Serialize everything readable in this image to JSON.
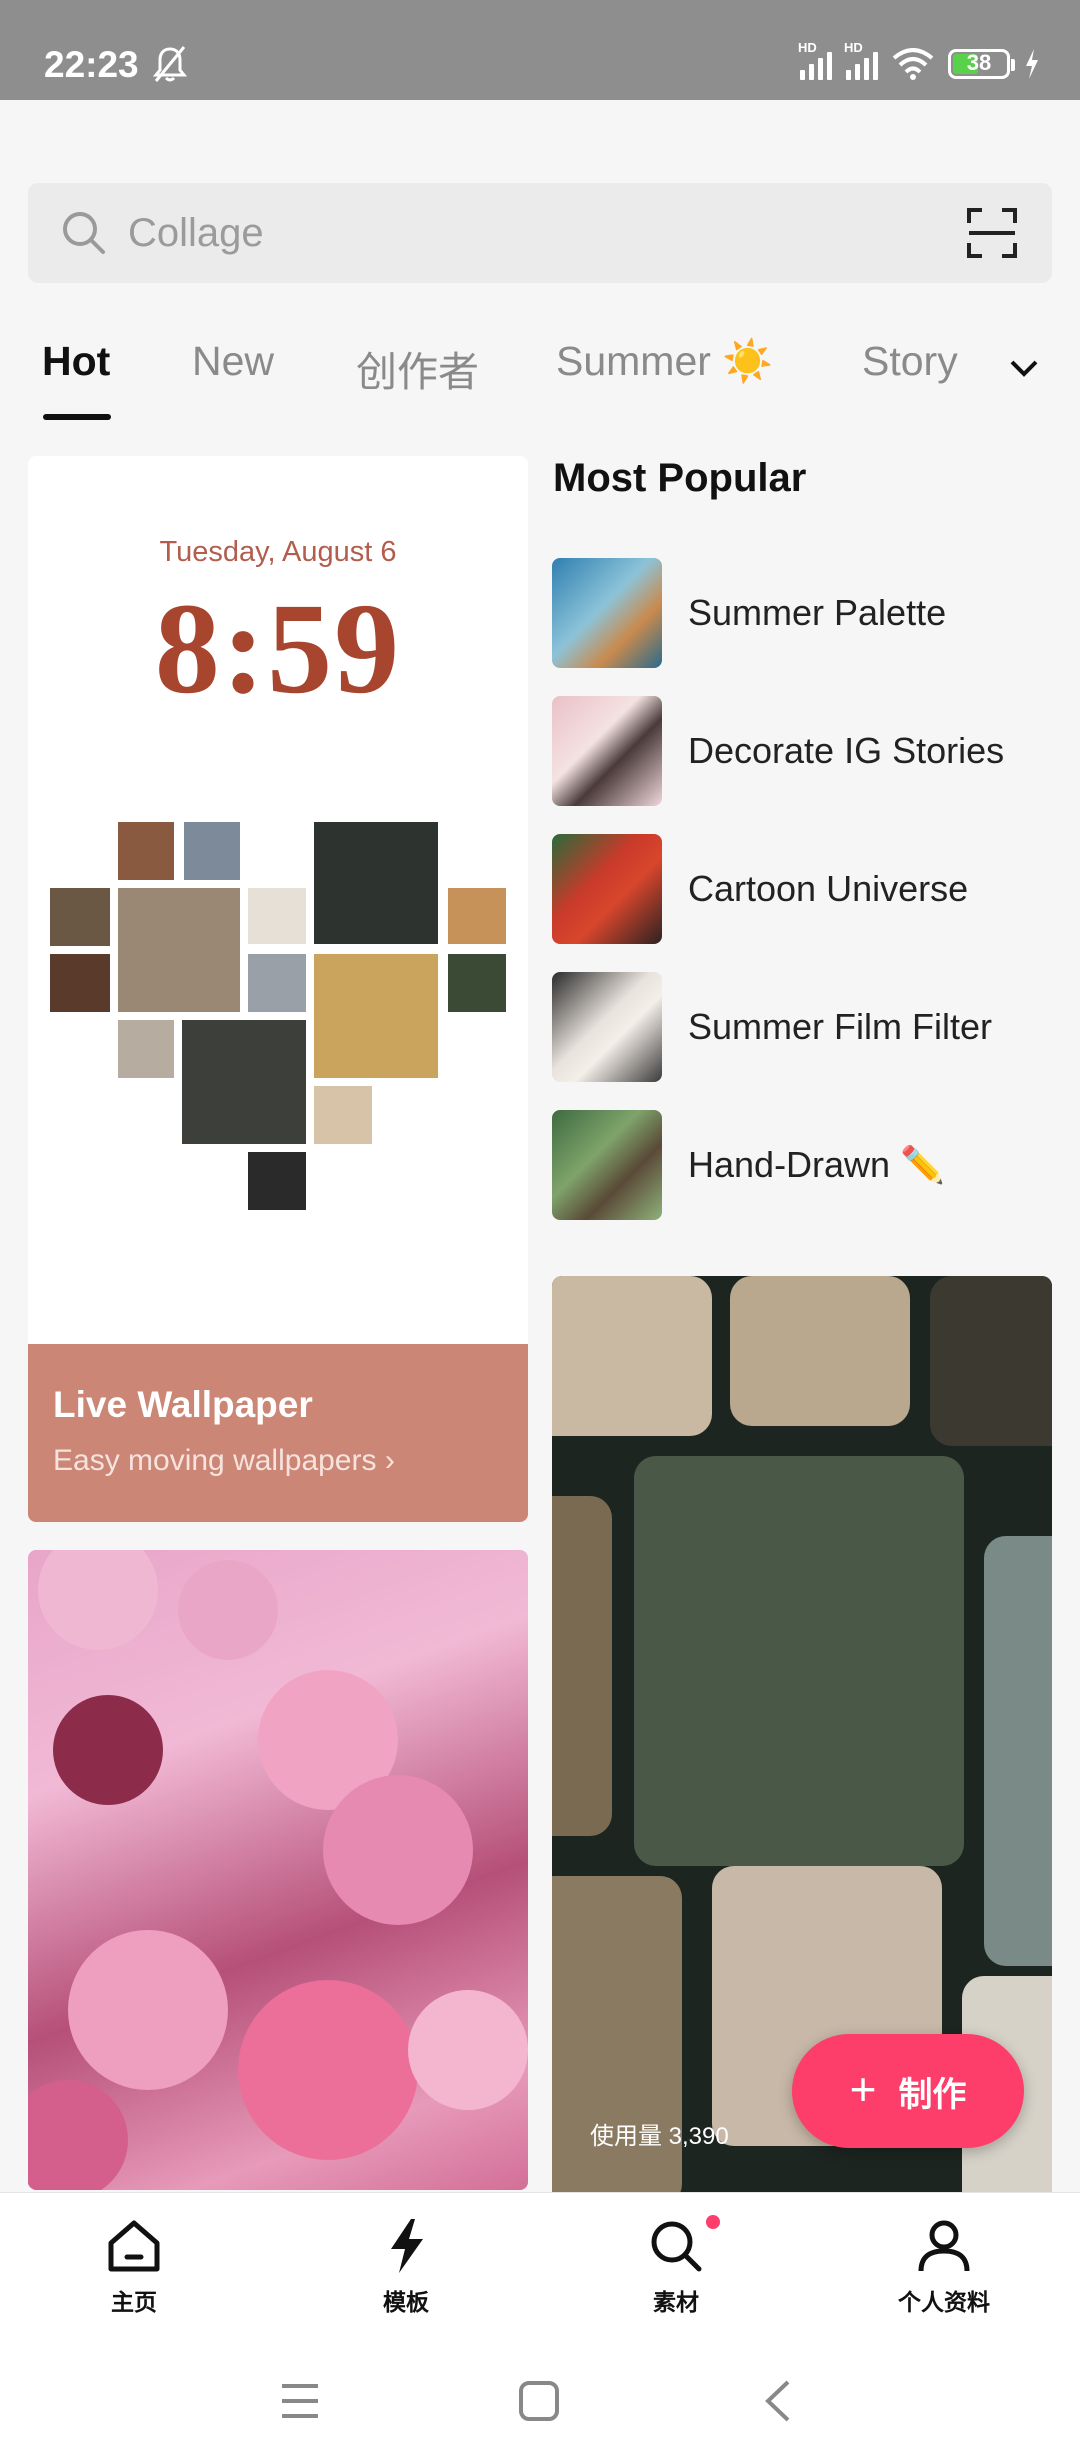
{
  "status_bar": {
    "time": "22:23",
    "battery": "38",
    "hd1": "HD",
    "hd2": "HD"
  },
  "search": {
    "placeholder": "Collage"
  },
  "tabs": [
    {
      "label": "Hot"
    },
    {
      "label": "New"
    },
    {
      "label": "创作者"
    },
    {
      "label": "Summer ☀️"
    },
    {
      "label": "Story"
    }
  ],
  "live_card": {
    "date": "Tuesday, August 6",
    "clock": "8:59",
    "title": "Live Wallpaper",
    "subtitle": "Easy moving wallpapers ›"
  },
  "most_popular": {
    "title": "Most Popular",
    "items": [
      {
        "label": "Summer Palette"
      },
      {
        "label": "Decorate IG Stories"
      },
      {
        "label": "Cartoon Universe"
      },
      {
        "label": "Summer Film Filter"
      },
      {
        "label": "Hand-Drawn ✏️"
      }
    ]
  },
  "film_card": {
    "usage": "使用量 3,390"
  },
  "make_button": {
    "label": "制作",
    "icon": "plus-icon"
  },
  "bottom_nav": [
    {
      "label": "主页",
      "icon": "home-icon"
    },
    {
      "label": "模板",
      "icon": "lightning-icon"
    },
    {
      "label": "素材",
      "icon": "search-icon"
    },
    {
      "label": "个人资料",
      "icon": "person-icon"
    }
  ],
  "colors": {
    "accent": "#fd3e6b",
    "live_footer": "#cb8676",
    "clock": "#a8452f"
  }
}
